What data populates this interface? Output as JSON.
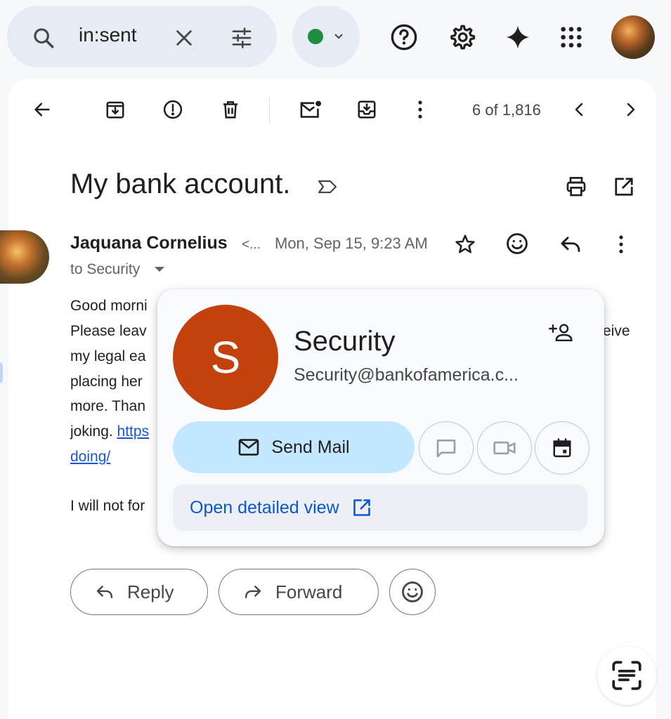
{
  "search": {
    "query": "in:sent"
  },
  "toolbar": {
    "counter": "6 of 1,816"
  },
  "email": {
    "subject": "My bank account.",
    "sender_name": "Jaquana Cornelius",
    "sender_email_truncated": "<...",
    "date": "Mon, Sep 15, 9:23 AM",
    "to_line": "to Security",
    "body_lines": [
      "Good morni",
      "Please leav",
      "my legal ea",
      "placing her",
      "more. Than",
      "joking. "
    ],
    "body_link_a": "https",
    "body_link_b": "doing/",
    "body_right_fragment": "eive",
    "closing_line": "I will not for"
  },
  "actions": {
    "reply_label": "Reply",
    "forward_label": "Forward"
  },
  "contact_card": {
    "initial": "S",
    "name": "Security",
    "email": "Security@bankofamerica.c...",
    "send_mail_label": "Send Mail",
    "open_view_label": "Open detailed view",
    "avatar_color": "#c2410c",
    "send_mail_bg": "#c2e7ff"
  },
  "colors": {
    "status_dot": "#1e8e3e",
    "accent": "#0b57d0",
    "background": "#f6f8fc"
  },
  "icons": [
    "search-icon",
    "clear-icon",
    "filter-icon",
    "status-dot",
    "chevron-down-icon",
    "help-icon",
    "gear-icon",
    "sparkle-icon",
    "apps-grid-icon",
    "back-arrow-icon",
    "archive-icon",
    "report-spam-icon",
    "delete-icon",
    "mark-unread-icon",
    "move-to-icon",
    "more-vert-icon",
    "chevron-left-icon",
    "chevron-right-icon",
    "label-icon",
    "print-icon",
    "open-new-window-icon",
    "star-icon",
    "emoji-icon",
    "reply-icon",
    "add-contact-icon",
    "mail-icon",
    "chat-icon",
    "video-icon",
    "calendar-icon",
    "external-link-icon",
    "forward-icon",
    "scan-text-icon"
  ]
}
